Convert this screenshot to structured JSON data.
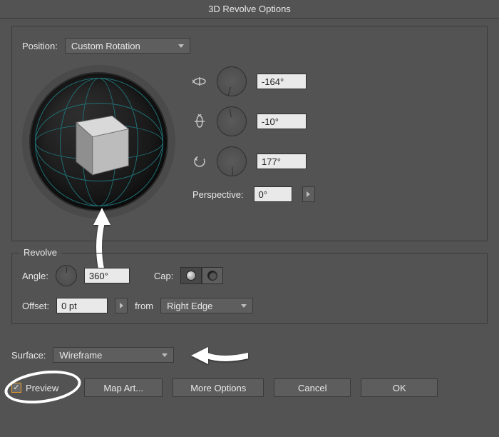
{
  "title": "3D Revolve Options",
  "position": {
    "label": "Position:",
    "dropdown": "Custom Rotation",
    "axis_x": "-164°",
    "axis_y": "-10°",
    "axis_z": "177°",
    "perspective_label": "Perspective:",
    "perspective_value": "0°"
  },
  "revolve": {
    "group_label": "Revolve",
    "angle_label": "Angle:",
    "angle_value": "360°",
    "cap_label": "Cap:",
    "offset_label": "Offset:",
    "offset_value": "0 pt",
    "from_label": "from",
    "from_value": "Right Edge"
  },
  "surface": {
    "label": "Surface:",
    "value": "Wireframe"
  },
  "footer": {
    "preview_label": "Preview",
    "map_art": "Map Art...",
    "more_options": "More Options",
    "cancel": "Cancel",
    "ok": "OK"
  }
}
